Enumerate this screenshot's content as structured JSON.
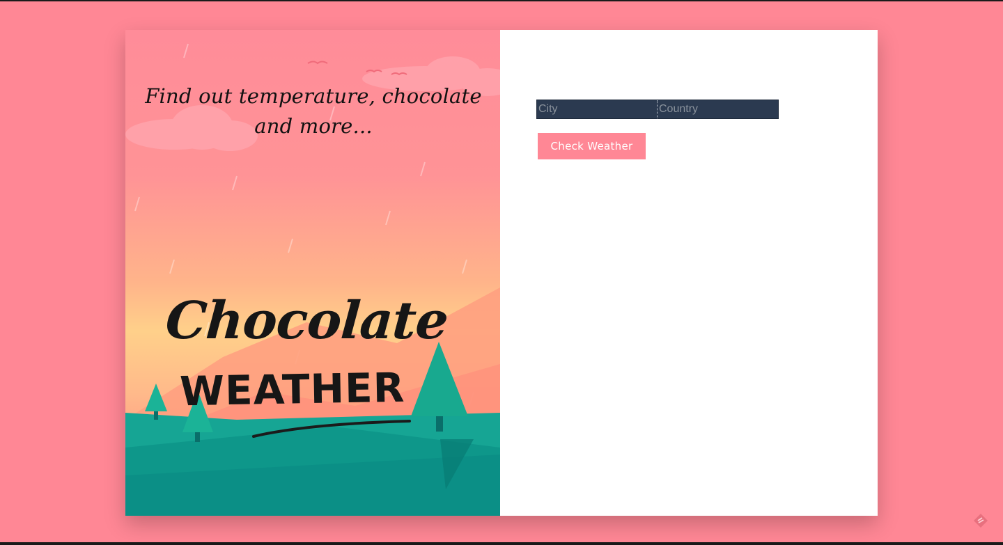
{
  "hero": {
    "tagline": "Find out temperature, chocolate and more...",
    "logo_line1": "Chocolate",
    "logo_line2": "WEATHER"
  },
  "form": {
    "city_placeholder": "City",
    "country_placeholder": "Country",
    "submit_label": "Check Weather"
  },
  "colors": {
    "page_background": "#ff8795",
    "input_background": "#2b3a50",
    "button_background": "#ff8795",
    "hill_teal": "#16a594"
  },
  "icons": {
    "corner": "codepen-feather-icon"
  }
}
